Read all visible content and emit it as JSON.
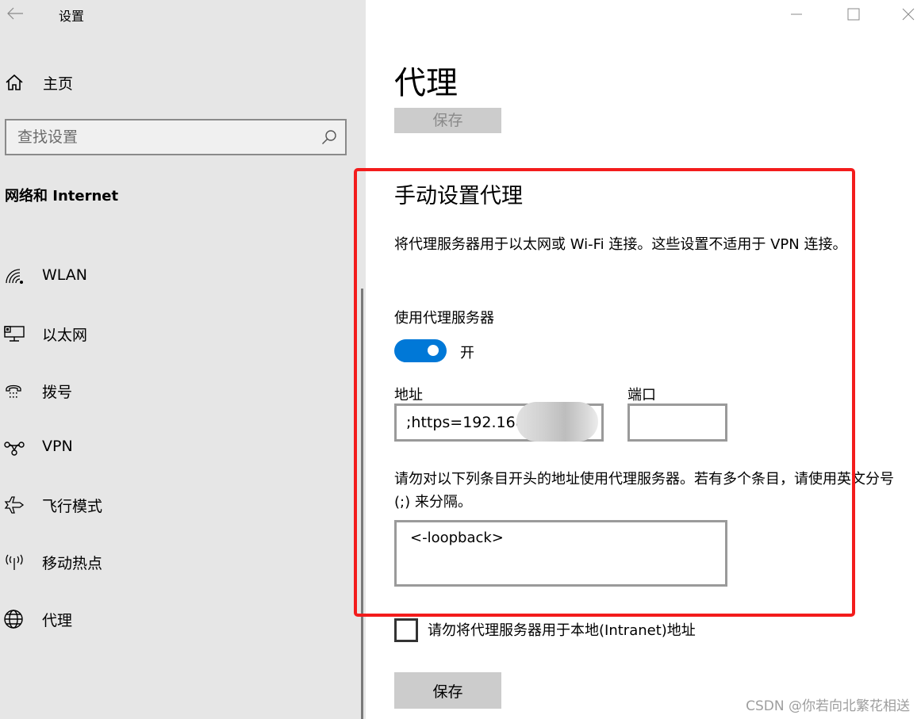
{
  "window": {
    "title": "设置",
    "controls": {
      "minimize_icon": "minimize-icon",
      "maximize_icon": "maximize-icon",
      "close_icon": "close-icon"
    }
  },
  "sidebar": {
    "back_icon": "arrow-left-icon",
    "home": {
      "label": "主页",
      "icon": "home-icon"
    },
    "search": {
      "placeholder": "查找设置",
      "value": "",
      "icon": "search-icon"
    },
    "section_heading": "网络和 Internet",
    "items": [
      {
        "label": "WLAN",
        "icon": "wifi-icon"
      },
      {
        "label": "以太网",
        "icon": "ethernet-icon"
      },
      {
        "label": "拨号",
        "icon": "dialup-icon"
      },
      {
        "label": "VPN",
        "icon": "vpn-icon"
      },
      {
        "label": "飞行模式",
        "icon": "airplane-icon"
      },
      {
        "label": "移动热点",
        "icon": "hotspot-icon"
      },
      {
        "label": "代理",
        "icon": "globe-icon"
      }
    ]
  },
  "main": {
    "page_title": "代理",
    "save_top_label": "保存",
    "manual_section_title": "手动设置代理",
    "description": "将代理服务器用于以太网或 Wi-Fi 连接。这些设置不适用于 VPN 连接。",
    "use_proxy_label": "使用代理服务器",
    "use_proxy_toggle": {
      "state": "开",
      "on": true,
      "color": "#0078d7"
    },
    "address": {
      "label": "地址",
      "value": ";https=192.168"
    },
    "port": {
      "label": "端口",
      "value": ""
    },
    "exceptions_description": "请勿对以下列条目开头的地址使用代理服务器。若有多个条目，请使用英文分号 (;) 来分隔。",
    "exceptions_value": "<-loopback>",
    "local_bypass": {
      "label": "请勿将代理服务器用于本地(Intranet)地址",
      "checked": false
    },
    "save_bottom_label": "保存",
    "highlight_color": "#f31c1c"
  },
  "watermark": "CSDN @你若向北繁花相送"
}
